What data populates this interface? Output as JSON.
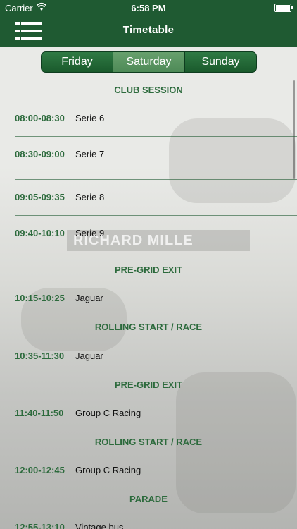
{
  "status_bar": {
    "carrier": "Carrier",
    "time": "6:58 PM"
  },
  "navbar": {
    "title": "Timetable"
  },
  "tabs": [
    {
      "label": "Friday",
      "active": false
    },
    {
      "label": "Saturday",
      "active": true
    },
    {
      "label": "Sunday",
      "active": false
    }
  ],
  "background_text": "RICHARD MILLE",
  "schedule": {
    "sections": [
      {
        "title": "CLUB SESSION"
      },
      {
        "title": "PRE-GRID EXIT"
      },
      {
        "title": "ROLLING START / RACE"
      },
      {
        "title": "PRE-GRID EXIT"
      },
      {
        "title": "ROLLING START / RACE"
      },
      {
        "title": "PARADE"
      }
    ],
    "rows": [
      {
        "time": "08:00-08:30",
        "name": "Serie 6"
      },
      {
        "time": "08:30-09:00",
        "name": "Serie 7"
      },
      {
        "time": "09:05-09:35",
        "name": "Serie 8"
      },
      {
        "time": "09:40-10:10",
        "name": "Serie 9"
      },
      {
        "time": "10:15-10:25",
        "name": "Jaguar"
      },
      {
        "time": "10:35-11:30",
        "name": "Jaguar"
      },
      {
        "time": "11:40-11:50",
        "name": "Group C Racing"
      },
      {
        "time": "12:00-12:45",
        "name": "Group C Racing"
      },
      {
        "time": "12:55-13:10",
        "name": "Vintage bus"
      }
    ]
  },
  "colors": {
    "brand_green": "#1f5a32",
    "accent_green": "#2c6a3c"
  }
}
